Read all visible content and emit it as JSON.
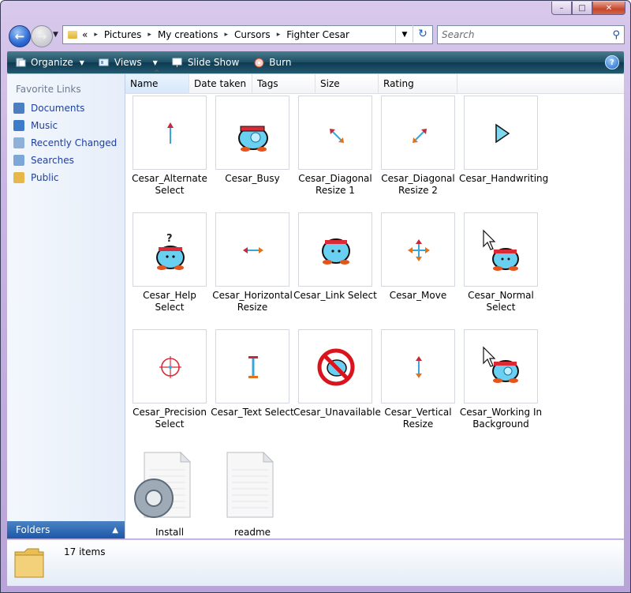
{
  "window": {
    "minimize": "–",
    "maximize": "□",
    "close": "✕"
  },
  "nav": {
    "breadcrumbs": [
      "Pictures",
      "My creations",
      "Cursors",
      "Fighter Cesar"
    ],
    "overflow": "«",
    "search_placeholder": "Search"
  },
  "toolbar": {
    "organize": "Organize",
    "views": "Views",
    "slideshow": "Slide Show",
    "burn": "Burn",
    "help": "?"
  },
  "sidebar": {
    "heading": "Favorite Links",
    "items": [
      {
        "label": "Documents",
        "icon": "documents-icon",
        "color": "#4b7fc2"
      },
      {
        "label": "Music",
        "icon": "music-icon",
        "color": "#3d7cc9"
      },
      {
        "label": "Recently Changed",
        "icon": "recently-changed-icon",
        "color": "#8fb0d8"
      },
      {
        "label": "Searches",
        "icon": "searches-icon",
        "color": "#7ea7d9"
      },
      {
        "label": "Public",
        "icon": "public-folder-icon",
        "color": "#e6b84a"
      }
    ],
    "folders_label": "Folders"
  },
  "columns": [
    "Name",
    "Date taken",
    "Tags",
    "Size",
    "Rating"
  ],
  "files": [
    {
      "name": "Cesar_Alternate Select",
      "icon": "alternate-select-cursor-icon"
    },
    {
      "name": "Cesar_Busy",
      "icon": "busy-cursor-icon"
    },
    {
      "name": "Cesar_Diagonal Resize 1",
      "icon": "diagonal-resize-1-cursor-icon"
    },
    {
      "name": "Cesar_Diagonal Resize 2",
      "icon": "diagonal-resize-2-cursor-icon"
    },
    {
      "name": "Cesar_Handwriting",
      "icon": "handwriting-cursor-icon"
    },
    {
      "name": "Cesar_Help Select",
      "icon": "help-select-cursor-icon"
    },
    {
      "name": "Cesar_Horizontal Resize",
      "icon": "horizontal-resize-cursor-icon"
    },
    {
      "name": "Cesar_Link Select",
      "icon": "link-select-cursor-icon"
    },
    {
      "name": "Cesar_Move",
      "icon": "move-cursor-icon"
    },
    {
      "name": "Cesar_Normal Select",
      "icon": "normal-select-cursor-icon"
    },
    {
      "name": "Cesar_Precision Select",
      "icon": "precision-select-cursor-icon"
    },
    {
      "name": "Cesar_Text Select",
      "icon": "text-select-cursor-icon"
    },
    {
      "name": "Cesar_Unavailable",
      "icon": "unavailable-cursor-icon"
    },
    {
      "name": "Cesar_Vertical Resize",
      "icon": "vertical-resize-cursor-icon"
    },
    {
      "name": "Cesar_Working In Background",
      "icon": "working-in-background-cursor-icon"
    },
    {
      "name": "Install",
      "icon": "install-settings-file-icon"
    },
    {
      "name": "readme",
      "icon": "text-document-icon"
    }
  ],
  "status": {
    "count": "17 items"
  }
}
